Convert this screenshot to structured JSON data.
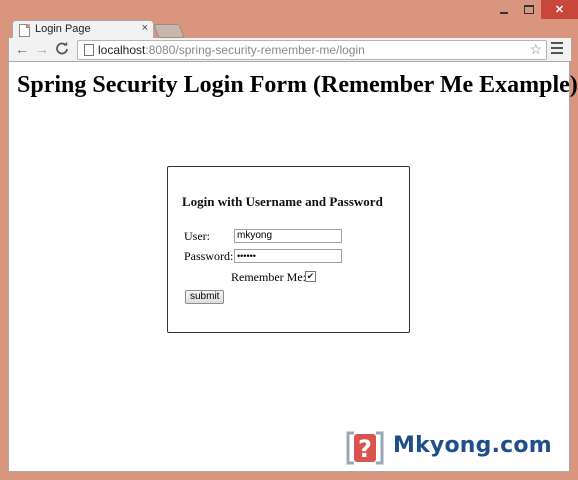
{
  "browser": {
    "tab": {
      "title": "Login Page",
      "close_glyph": "×",
      "favicon_icon": "page-icon"
    },
    "window_controls": {
      "close_glyph": "✕"
    },
    "nav": {
      "back_glyph": "←",
      "forward_glyph": "→",
      "reload_glyph": "C"
    },
    "address": {
      "host": "localhost",
      "rest": ":8080/spring-security-remember-me/login"
    },
    "star_glyph": "☆",
    "colors": {
      "frame": "#d9957e",
      "close_button": "#c9463d"
    }
  },
  "page": {
    "heading": "Spring Security Login Form (Remember Me Example)",
    "form": {
      "title": "Login with Username and Password",
      "user_label": "User:",
      "user_value": "mkyong",
      "password_label": "Password:",
      "password_value": "••••••",
      "remember_label": "Remember Me:",
      "remember_checked": true,
      "remember_glyph": "✔",
      "submit_label": "submit"
    }
  },
  "watermark": {
    "text": "Mkyong.com",
    "colors": {
      "text": "#1f4e8c",
      "mark": "#d9534f"
    }
  }
}
